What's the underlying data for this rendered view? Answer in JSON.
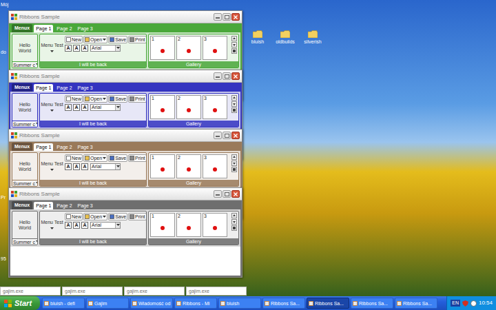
{
  "desktop": {
    "edge_labels": [
      "Mój",
      "do",
      "Pr",
      "95"
    ],
    "folders": [
      {
        "label": "bluish"
      },
      {
        "label": "oldbuilds"
      },
      {
        "label": "silverish"
      }
    ]
  },
  "windows": [
    {
      "title": "Ribbons Sample",
      "color": "#4aa83a",
      "menu_button": "Menux",
      "tabs": [
        {
          "label": "Page 1",
          "selected": true
        },
        {
          "label": "Page 2",
          "selected": false
        },
        {
          "label": "Page 3",
          "selected": false
        }
      ],
      "hello_button": "Hello World",
      "style_combo": "Summer c",
      "large_button": "Menu Test",
      "small_buttons": [
        {
          "label": "New",
          "dropdown": false
        },
        {
          "label": "Open",
          "dropdown": true
        },
        {
          "label": "Save",
          "dropdown": false
        },
        {
          "label": "Print",
          "dropdown": false
        }
      ],
      "font_buttons": [
        "A",
        "A",
        "A"
      ],
      "font": "Arial",
      "group_caption": "I will be back",
      "gallery": {
        "caption": "Gallery",
        "items": [
          "1",
          "2",
          "3"
        ]
      }
    },
    {
      "title": "Ribbons Sample",
      "color": "#3434c0",
      "menu_button": "Menux",
      "tabs": [
        {
          "label": "Page 1",
          "selected": true
        },
        {
          "label": "Page 2",
          "selected": false
        },
        {
          "label": "Page 3",
          "selected": false
        }
      ],
      "hello_button": "Hello World",
      "style_combo": "Summer c",
      "large_button": "Menu Test",
      "small_buttons": [
        {
          "label": "New",
          "dropdown": false
        },
        {
          "label": "Open",
          "dropdown": true
        },
        {
          "label": "Save",
          "dropdown": false
        },
        {
          "label": "Print",
          "dropdown": false
        }
      ],
      "font_buttons": [
        "A",
        "A",
        "A"
      ],
      "font": "Arial",
      "group_caption": "I will be back",
      "gallery": {
        "caption": "Gallery",
        "items": [
          "1",
          "2",
          "3"
        ]
      }
    },
    {
      "title": "Ribbons Sample",
      "color": "#9a7a5a",
      "menu_button": "Menux",
      "tabs": [
        {
          "label": "Page 1",
          "selected": true
        },
        {
          "label": "Page 2",
          "selected": false
        },
        {
          "label": "Page 3",
          "selected": false
        }
      ],
      "hello_button": "Hello World",
      "style_combo": "Summer c",
      "large_button": "Menu Test",
      "small_buttons": [
        {
          "label": "New",
          "dropdown": false
        },
        {
          "label": "Open",
          "dropdown": true
        },
        {
          "label": "Save",
          "dropdown": false
        },
        {
          "label": "Print",
          "dropdown": false
        }
      ],
      "font_buttons": [
        "A",
        "A",
        "A"
      ],
      "font": "Arial",
      "group_caption": "I will be back",
      "gallery": {
        "caption": "Gallery",
        "items": [
          "1",
          "2",
          "3"
        ]
      }
    },
    {
      "title": "Ribbons Sample",
      "color": "#6e6e6e",
      "menu_button": "Menux",
      "tabs": [
        {
          "label": "Page 1",
          "selected": true
        },
        {
          "label": "Page 2",
          "selected": false
        },
        {
          "label": "Page 3",
          "selected": false
        }
      ],
      "hello_button": "Hello World",
      "style_combo": "Summer c",
      "large_button": "Menu Test",
      "small_buttons": [
        {
          "label": "New",
          "dropdown": false
        },
        {
          "label": "Open",
          "dropdown": true
        },
        {
          "label": "Save",
          "dropdown": false
        },
        {
          "label": "Print",
          "dropdown": false
        }
      ],
      "font_buttons": [
        "A",
        "A",
        "A"
      ],
      "font": "Arial",
      "group_caption": "I will be back",
      "gallery": {
        "caption": "Gallery",
        "items": [
          "1",
          "2",
          "3"
        ]
      }
    }
  ],
  "process_strip": [
    "gajim.exe",
    "gajim.exe",
    "gajim.exe",
    "gajim.exe"
  ],
  "taskbar": {
    "start": "Start",
    "tasks": [
      {
        "label": "bluish - defi",
        "selected": false
      },
      {
        "label": "Gajim",
        "selected": false
      },
      {
        "label": "Wiadomość od",
        "selected": false
      },
      {
        "label": "Ribbons - Mi",
        "selected": false
      },
      {
        "label": "bluish",
        "selected": false
      },
      {
        "label": "Ribbons Sa...",
        "selected": false
      },
      {
        "label": "Ribbons Sa...",
        "selected": true
      },
      {
        "label": "Ribbons Sa...",
        "selected": false
      },
      {
        "label": "Ribbons Sa...",
        "selected": false
      }
    ],
    "language": "EN",
    "clock": "10:54"
  }
}
